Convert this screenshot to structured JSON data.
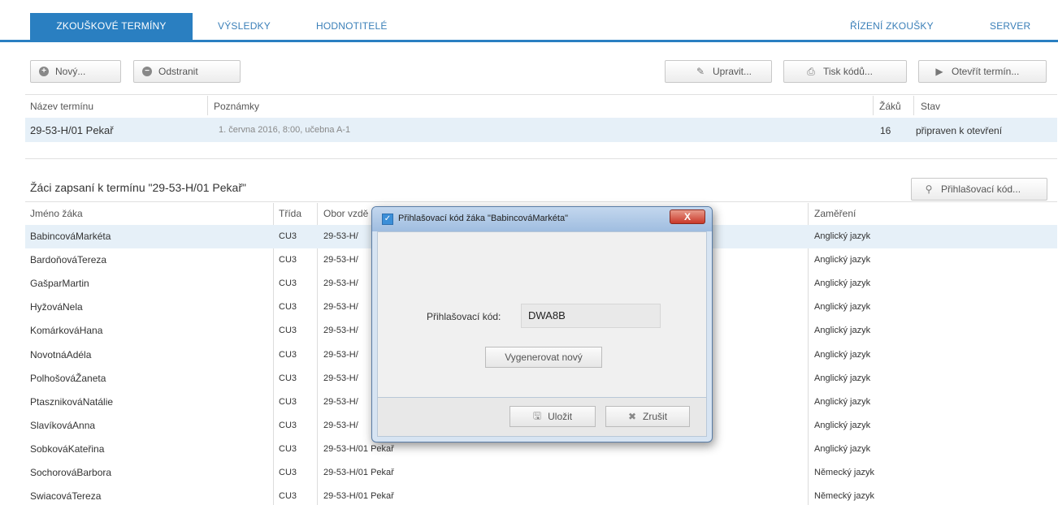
{
  "tabs": {
    "zkouskove_terminy": "ZKOUŠKOVÉ TERMÍNY",
    "vysledky": "VÝSLEDKY",
    "hodnotitele": "HODNOTITELÉ",
    "rizeni_zkousky": "ŘÍZENÍ ZKOUŠKY",
    "server": "SERVER"
  },
  "toolbar": {
    "new_label": "Nový...",
    "remove_label": "Odstranit",
    "edit_label": "Upravit...",
    "print_label": "Tisk kódů...",
    "open_label": "Otevřít termín..."
  },
  "terms_table": {
    "headers": {
      "name": "Název termínu",
      "notes": "Poznámky",
      "students": "Žáků",
      "status": "Stav"
    },
    "rows": [
      {
        "name": "29-53-H/01 Pekař",
        "notes": "1. června 2016, 8:00, učebna A-1",
        "students": "16",
        "status": "připraven k otevření"
      }
    ]
  },
  "students_section": {
    "title": "Žáci zapsaní k termínu \"29-53-H/01 Pekař\"",
    "login_code_button": "Přihlašovací kód..."
  },
  "students_table": {
    "headers": {
      "name": "Jméno žáka",
      "class": "Třída",
      "field": "Obor vzdě",
      "focus": "Zaměření"
    },
    "rows": [
      {
        "name": "BabincováMarkéta",
        "class": "CU3",
        "field": "29-53-H/",
        "focus": "Anglický jazyk"
      },
      {
        "name": "BardoňováTereza",
        "class": "CU3",
        "field": "29-53-H/",
        "focus": "Anglický jazyk"
      },
      {
        "name": "GašparMartin",
        "class": "CU3",
        "field": "29-53-H/",
        "focus": "Anglický jazyk"
      },
      {
        "name": "HyžováNela",
        "class": "CU3",
        "field": "29-53-H/",
        "focus": "Anglický jazyk"
      },
      {
        "name": "KomárkováHana",
        "class": "CU3",
        "field": "29-53-H/",
        "focus": "Anglický jazyk"
      },
      {
        "name": "NovotnáAdéla",
        "class": "CU3",
        "field": "29-53-H/",
        "focus": "Anglický jazyk"
      },
      {
        "name": "PolhošováŽaneta",
        "class": "CU3",
        "field": "29-53-H/",
        "focus": "Anglický jazyk"
      },
      {
        "name": "PtasznikováNatálie",
        "class": "CU3",
        "field": "29-53-H/",
        "focus": "Anglický jazyk"
      },
      {
        "name": "SlavíkováAnna",
        "class": "CU3",
        "field": "29-53-H/",
        "focus": "Anglický jazyk"
      },
      {
        "name": "SobkováKateřina",
        "class": "CU3",
        "field": "29-53-H/01 Pekař",
        "focus": "Anglický jazyk"
      },
      {
        "name": "SochorováBarbora",
        "class": "CU3",
        "field": "29-53-H/01 Pekař",
        "focus": "Německý jazyk"
      },
      {
        "name": "SwiacováTereza",
        "class": "CU3",
        "field": "29-53-H/01 Pekař",
        "focus": "Německý jazyk"
      }
    ]
  },
  "dialog": {
    "title": "Přihlašovací kód žáka \"BabincováMarkéta\"",
    "code_label": "Přihlašovací kód:",
    "code_value": "DWA8B",
    "generate_label": "Vygenerovat nový",
    "save_label": "Uložit",
    "cancel_label": "Zrušit",
    "close_glyph": "X"
  },
  "colors": {
    "accent": "#2a7fc1",
    "selected_row": "#e6f0f8"
  }
}
